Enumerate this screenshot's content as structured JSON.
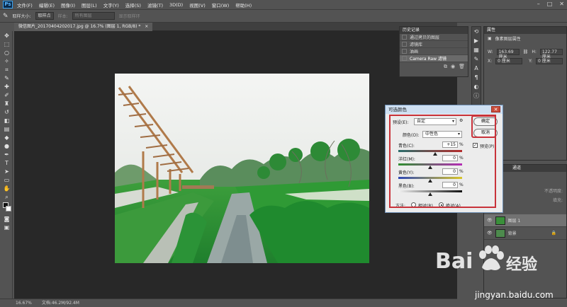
{
  "menubar": {
    "logo": "Ps",
    "items": [
      "文件(F)",
      "编辑(E)",
      "图像(I)",
      "图层(L)",
      "文字(Y)",
      "选择(S)",
      "滤镜(T)",
      "3D(D)",
      "视图(V)",
      "窗口(W)",
      "帮助(H)"
    ]
  },
  "options": {
    "sample_size_label": "取样大小:",
    "sample_size_value": "取样点",
    "sample_label": "样本:",
    "sample_value": "所有图层",
    "show_ring": "显示取样环"
  },
  "doc_tab": {
    "title": "微信图片_20170404202017.jpg @ 16.7% (图层 1, RGB/8) *",
    "close": "×"
  },
  "history": {
    "title": "历史记录",
    "items": [
      "通过拷贝的图层",
      "滤镜库",
      "油画",
      "Camera Raw 滤镜"
    ],
    "selected_index": 3
  },
  "properties": {
    "title": "属性",
    "subtitle": "像素图层属性",
    "w_label": "W:",
    "w_value": "163.69 厘米",
    "h_label": "H:",
    "h_value": "122.77 厘米",
    "x_label": "X:",
    "x_value": "0 厘米",
    "y_label": "Y:",
    "y_value": "0 厘米"
  },
  "layers": {
    "title": "通道",
    "opacity_label": "不透明度:",
    "fill_label": "填充:",
    "items": [
      {
        "name": "图层 1",
        "selected": true
      },
      {
        "name": "背景",
        "selected": false
      }
    ]
  },
  "status": {
    "zoom": "16.67%",
    "doc": "文档:46.2M/92.4M"
  },
  "dialog": {
    "title": "可选颜色",
    "close": "✕",
    "preset_label": "预设(E):",
    "preset_value": "自定",
    "colors_label": "颜色(O):",
    "colors_value": "中性色",
    "ok": "确定",
    "cancel": "取消",
    "preview_label": "预览(P)",
    "preview_checked": true,
    "sliders": [
      {
        "label": "青色(C):",
        "value": "+15",
        "fraction": 0.575
      },
      {
        "label": "洋红(M):",
        "value": "0",
        "fraction": 0.5
      },
      {
        "label": "黄色(Y):",
        "value": "0",
        "fraction": 0.5
      },
      {
        "label": "黑色(B):",
        "value": "0",
        "fraction": 0.5
      }
    ],
    "unit": "%",
    "method_label": "方法:",
    "method_relative": "相对(R)",
    "method_absolute": "绝对(A)",
    "method_selected": "absolute"
  },
  "watermark": {
    "brand_left": "Bai",
    "brand_right": "经验",
    "url": "jingyan.baidu.com"
  },
  "colors": {
    "highlight": "#c8323a",
    "panel": "#535353",
    "canvas": "#282828"
  }
}
